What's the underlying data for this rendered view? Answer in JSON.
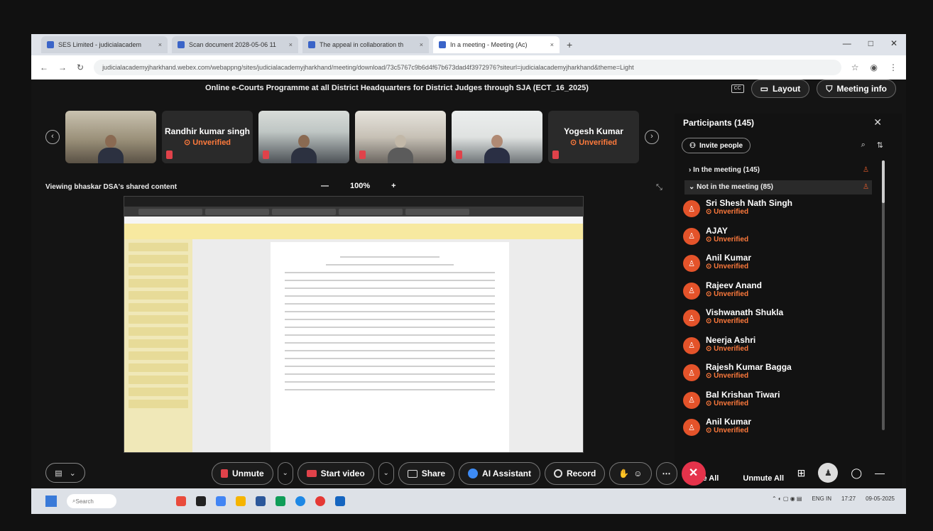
{
  "browser": {
    "tabs": [
      {
        "label": "SES Limited - judicialacadem"
      },
      {
        "label": "Scan document 2028-05-06 11"
      },
      {
        "label": "The appeal in collaboration th"
      },
      {
        "label": "In a meeting - Meeting (Ac)"
      }
    ],
    "new_tab": "+",
    "url": "judicialacademyjharkhand.webex.com/webappng/sites/judicialacademyjharkhand/meeting/download/73c5767c9b6d4f67b673dad4f3972976?siteurl=judicialacademyjharkhand&theme=Light"
  },
  "meeting": {
    "title": "Online e-Courts Programme at all District Headquarters for District Judges through SJA (ECT_16_2025)",
    "layout_label": "Layout",
    "meeting_info_label": "Meeting info",
    "viewing_label": "Viewing bhaskar DSA's shared content",
    "zoom_minus": "—",
    "zoom_level": "100%",
    "zoom_plus": "+",
    "tiles": [
      {
        "type": "video",
        "name": ""
      },
      {
        "type": "name",
        "name": "Randhir kumar singh",
        "status": "Unverified"
      },
      {
        "type": "video",
        "name": ""
      },
      {
        "type": "video",
        "name": ""
      },
      {
        "type": "video",
        "name": ""
      },
      {
        "type": "name",
        "name": "Yogesh Kumar",
        "status": "Unverified"
      }
    ]
  },
  "participants": {
    "header": "Participants (145)",
    "invite_label": "Invite people",
    "in_meeting": "In the meeting (145)",
    "not_in_meeting": "Not in the meeting (85)",
    "list": [
      {
        "name": "Sri Shesh Nath Singh",
        "status": "Unverified"
      },
      {
        "name": "AJAY",
        "status": "Unverified"
      },
      {
        "name": "Anil Kumar",
        "status": "Unverified"
      },
      {
        "name": "Rajeev Anand",
        "status": "Unverified"
      },
      {
        "name": "Vishwanath Shukla",
        "status": "Unverified"
      },
      {
        "name": "Neerja Ashri",
        "status": "Unverified"
      },
      {
        "name": "Rajesh Kumar Bagga",
        "status": "Unverified"
      },
      {
        "name": "Bal Krishan Tiwari",
        "status": "Unverified"
      },
      {
        "name": "Anil Kumar",
        "status": "Unverified"
      }
    ],
    "mute_all": "Mute All",
    "unmute_all": "Unmute All"
  },
  "controls": {
    "unmute": "Unmute",
    "start_video": "Start video",
    "share": "Share",
    "ai_assistant": "AI Assistant",
    "record": "Record"
  },
  "taskbar": {
    "search": "Search",
    "lang": "ENG IN",
    "time": "17:27",
    "date": "09-05-2025"
  },
  "colors": {
    "unverified": "#ff7a3c",
    "avatar": "#e4532a",
    "end_call": "#e5334b",
    "accent": "#3d8bf5"
  }
}
